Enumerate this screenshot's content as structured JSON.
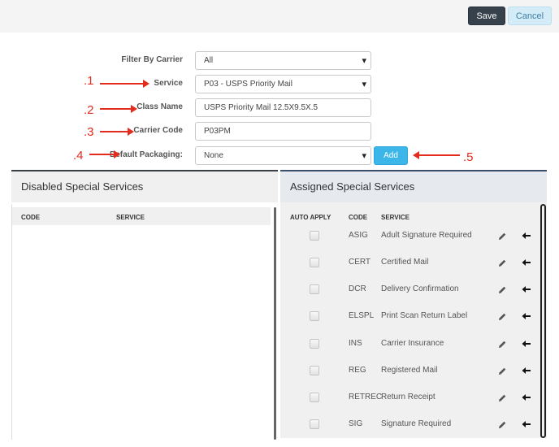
{
  "toolbar": {
    "save_label": "Save",
    "cancel_label": "Cancel"
  },
  "form": {
    "filter_by_carrier": {
      "label": "Filter By Carrier",
      "value": "All"
    },
    "service": {
      "label": "Service",
      "value": "P03 - USPS Priority Mail"
    },
    "class_name": {
      "label": "Class Name",
      "value": "USPS Priority Mail 12.5X9.5X.5"
    },
    "carrier_code": {
      "label": "Carrier Code",
      "value": "P03PM"
    },
    "default_packaging": {
      "label": "Default Packaging:",
      "value": "None"
    },
    "add_label": "Add"
  },
  "annotations": [
    ".1",
    ".2",
    ".3",
    ".4",
    ".5"
  ],
  "annotation_color": "#e32b1e",
  "disabled_panel": {
    "title": "Disabled Special Services",
    "headers": {
      "code": "CODE",
      "service": "SERVICE"
    }
  },
  "assigned_panel": {
    "title": "Assigned Special Services",
    "headers": {
      "auto_apply": "AUTO APPLY",
      "code": "CODE",
      "service": "SERVICE"
    },
    "rows": [
      {
        "code": "ASIG",
        "service": "Adult Signature Required",
        "checked": false
      },
      {
        "code": "CERT",
        "service": "Certified Mail",
        "checked": false
      },
      {
        "code": "DCR",
        "service": "Delivery Confirmation",
        "checked": false
      },
      {
        "code": "ELSPL",
        "service": "Print Scan Return Label",
        "checked": false
      },
      {
        "code": "INS",
        "service": "Carrier Insurance",
        "checked": false
      },
      {
        "code": "REG",
        "service": "Registered Mail",
        "checked": false
      },
      {
        "code": "RETREC",
        "service": "Return Receipt",
        "checked": false
      },
      {
        "code": "SIG",
        "service": "Signature Required",
        "checked": false
      }
    ]
  },
  "icons": {
    "edit": "pencil-icon",
    "remove": "arrow-left-icon"
  },
  "colors": {
    "save": "#36414c",
    "cancel": "#d3ecf7",
    "add": "#3cb6e8"
  }
}
